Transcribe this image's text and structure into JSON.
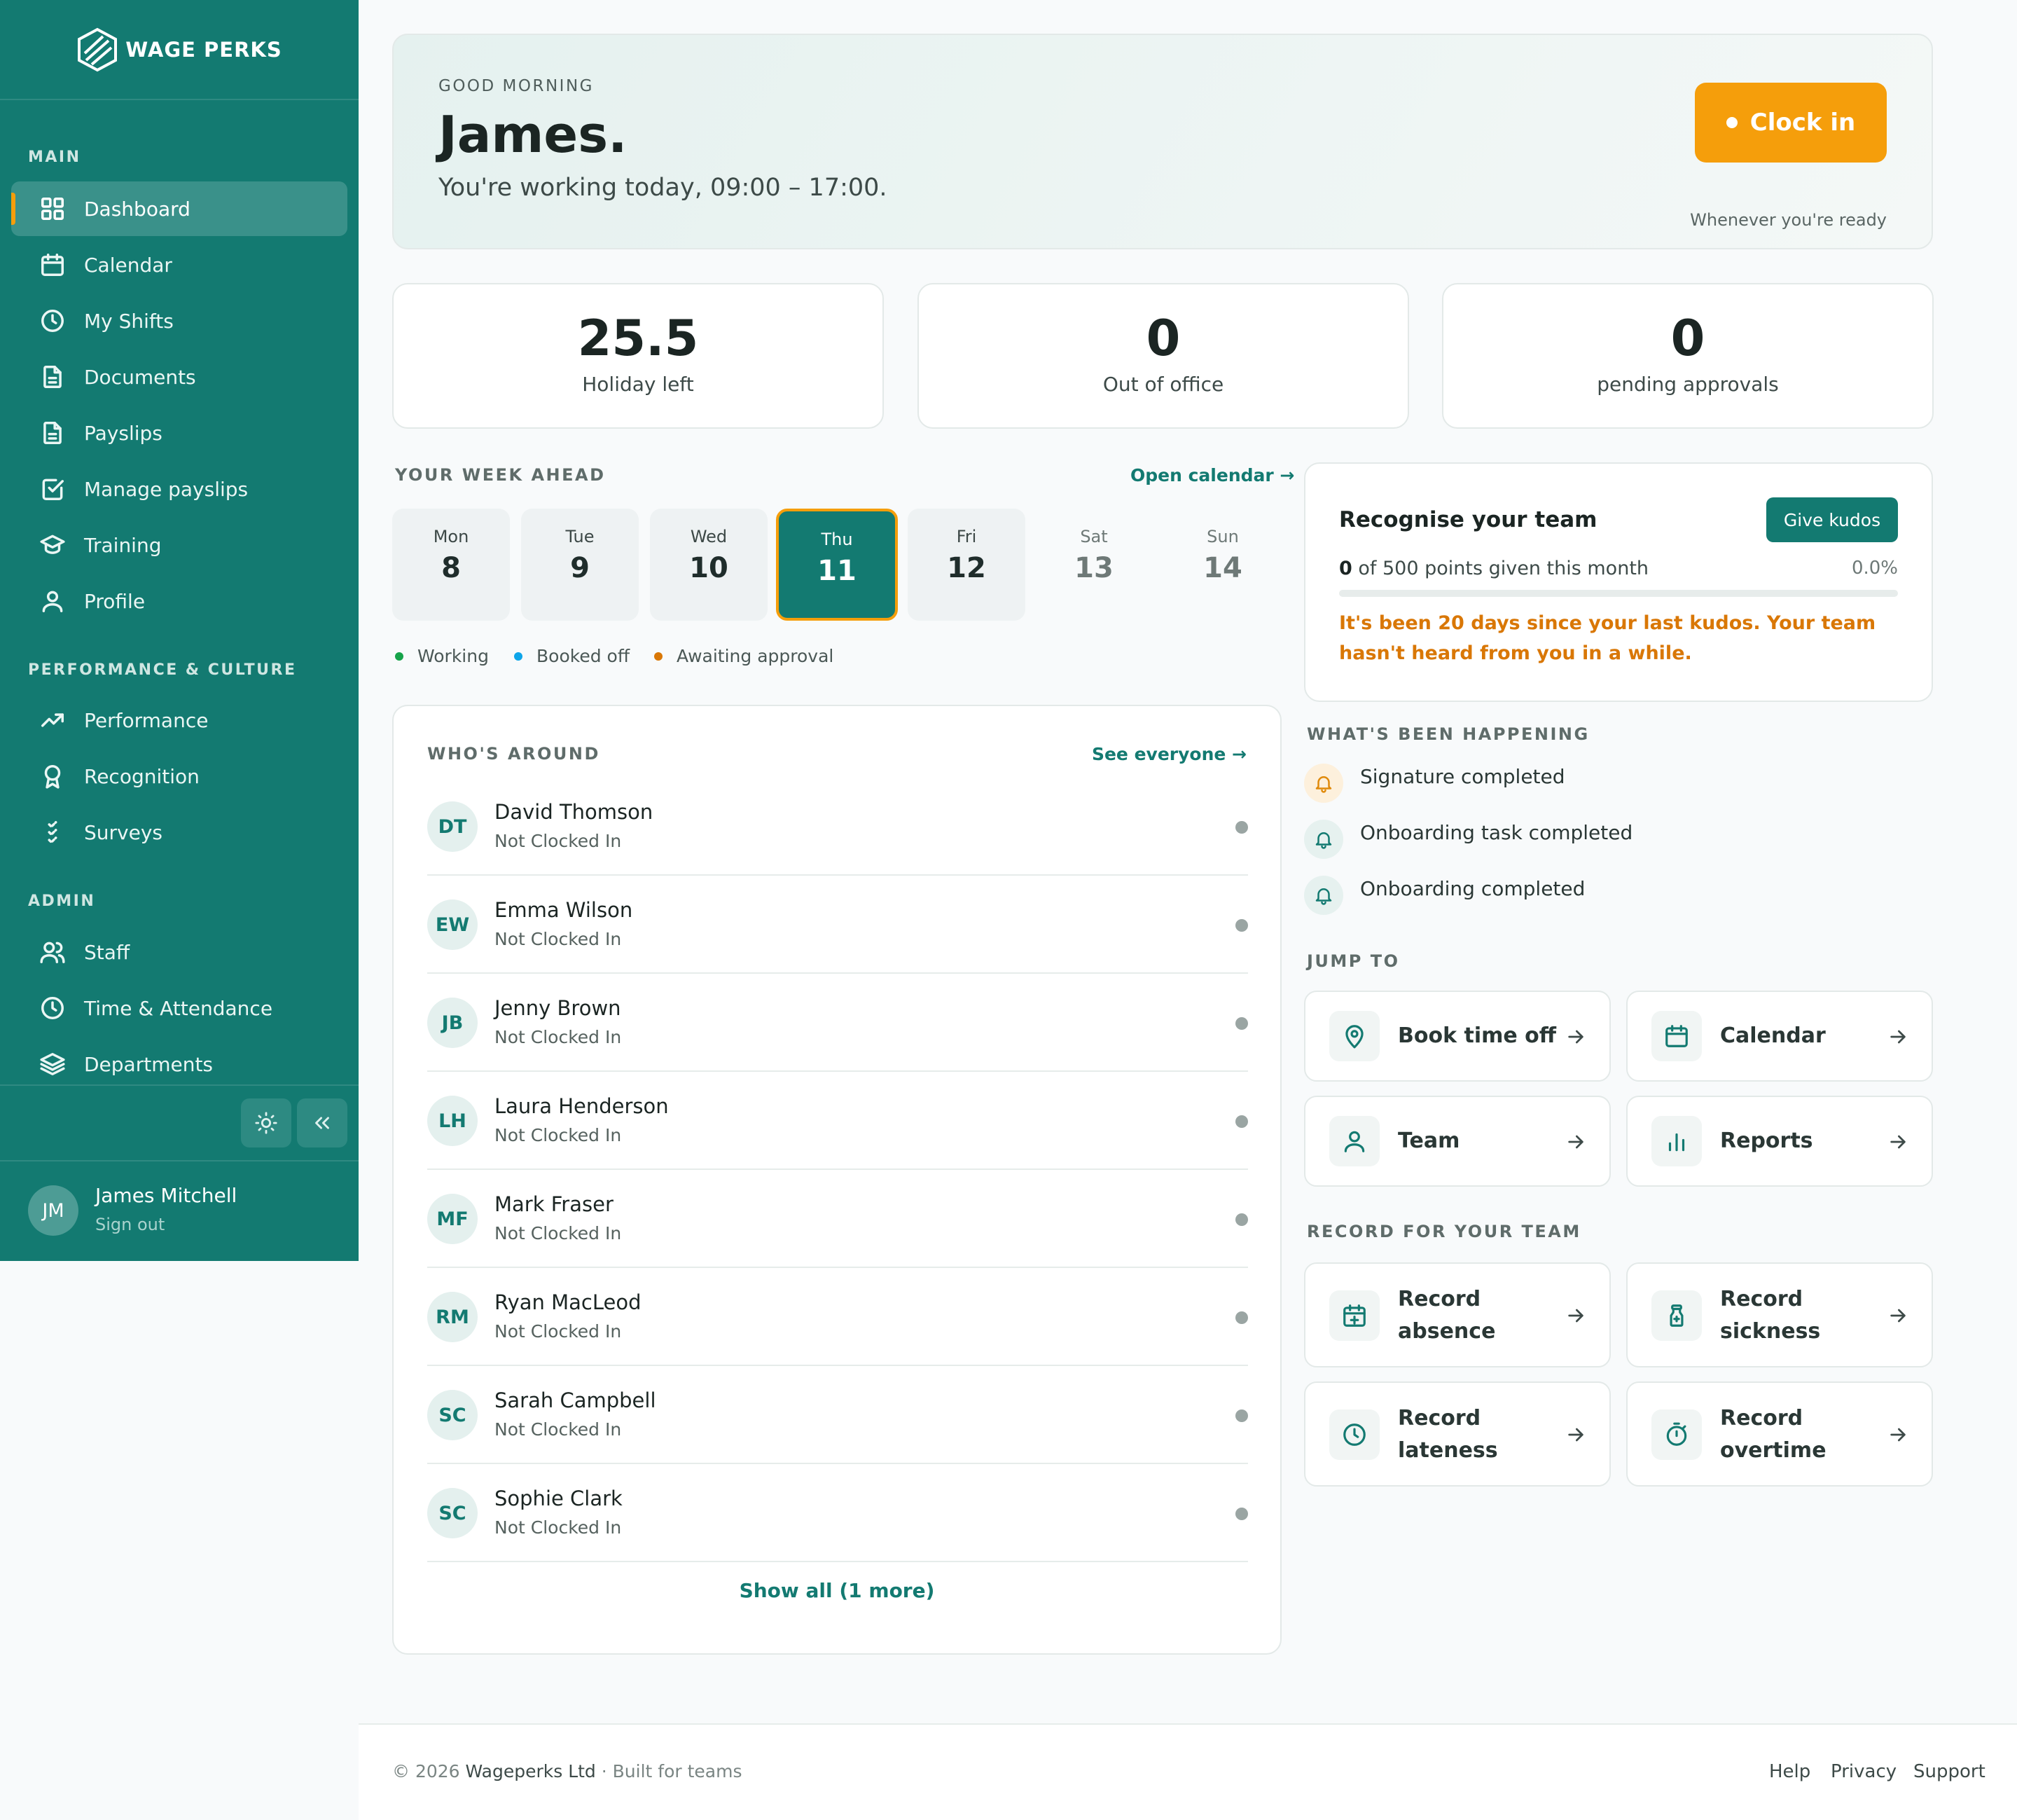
{
  "brand": {
    "name": "WAGE PERKS"
  },
  "sidebar": {
    "sections": {
      "main": "MAIN",
      "performance": "PERFORMANCE & CULTURE",
      "admin": "ADMIN"
    },
    "items": [
      {
        "label": "Dashboard",
        "icon": "grid-icon"
      },
      {
        "label": "Calendar",
        "icon": "calendar-icon"
      },
      {
        "label": "My Shifts",
        "icon": "clock-icon"
      },
      {
        "label": "Documents",
        "icon": "document-icon"
      },
      {
        "label": "Payslips",
        "icon": "document-icon"
      },
      {
        "label": "Manage payslips",
        "icon": "checkbox-icon"
      },
      {
        "label": "Training",
        "icon": "graduation-cap-icon"
      },
      {
        "label": "Profile",
        "icon": "user-icon"
      },
      {
        "label": "Performance",
        "icon": "trend-up-icon"
      },
      {
        "label": "Recognition",
        "icon": "award-icon"
      },
      {
        "label": "Surveys",
        "icon": "checklist-icon"
      },
      {
        "label": "Staff",
        "icon": "users-icon"
      },
      {
        "label": "Time & Attendance",
        "icon": "clock-icon"
      },
      {
        "label": "Departments",
        "icon": "layers-icon"
      }
    ],
    "user": {
      "initials": "JM",
      "name": "James Mitchell",
      "signout": "Sign out"
    }
  },
  "hero": {
    "eyebrow": "GOOD MORNING",
    "name": "James.",
    "subtitle": "You're working today, 09:00 – 17:00.",
    "clock_in": "Clock in",
    "clock_in_sub": "Whenever you're ready"
  },
  "stats": [
    {
      "value": "25.5",
      "label": "Holiday left"
    },
    {
      "value": "0",
      "label": "Out of office"
    },
    {
      "value": "0",
      "label": "pending approvals"
    }
  ],
  "week": {
    "title": "YOUR WEEK AHEAD",
    "link": "Open calendar →",
    "days": [
      {
        "name": "Mon",
        "num": "8"
      },
      {
        "name": "Tue",
        "num": "9"
      },
      {
        "name": "Wed",
        "num": "10"
      },
      {
        "name": "Thu",
        "num": "11"
      },
      {
        "name": "Fri",
        "num": "12"
      },
      {
        "name": "Sat",
        "num": "13"
      },
      {
        "name": "Sun",
        "num": "14"
      }
    ],
    "legend": [
      {
        "label": "Working",
        "color": "#16a34a"
      },
      {
        "label": "Booked off",
        "color": "#0ea5e9"
      },
      {
        "label": "Awaiting approval",
        "color": "#d97706"
      }
    ]
  },
  "who": {
    "title": "WHO'S AROUND",
    "link": "See everyone →",
    "people": [
      {
        "initials": "DT",
        "name": "David Thomson",
        "status": "Not Clocked In"
      },
      {
        "initials": "EW",
        "name": "Emma Wilson",
        "status": "Not Clocked In"
      },
      {
        "initials": "JB",
        "name": "Jenny Brown",
        "status": "Not Clocked In"
      },
      {
        "initials": "LH",
        "name": "Laura Henderson",
        "status": "Not Clocked In"
      },
      {
        "initials": "MF",
        "name": "Mark Fraser",
        "status": "Not Clocked In"
      },
      {
        "initials": "RM",
        "name": "Ryan MacLeod",
        "status": "Not Clocked In"
      },
      {
        "initials": "SC",
        "name": "Sarah Campbell",
        "status": "Not Clocked In"
      },
      {
        "initials": "SC",
        "name": "Sophie Clark",
        "status": "Not Clocked In"
      }
    ],
    "show_all": "Show all (1 more)"
  },
  "kudos": {
    "title": "Recognise your team",
    "button": "Give kudos",
    "points_value": "0",
    "points_text": " of 500 points given this month",
    "percent": "0.0%",
    "progress_fraction": 0,
    "warning": "It's been 20 days since your last kudos. Your team hasn't heard from you in a while."
  },
  "activity": {
    "title": "WHAT'S BEEN HAPPENING",
    "items": [
      {
        "text": "Signature completed",
        "icon": "bell-icon"
      },
      {
        "text": "Onboarding task completed",
        "icon": "bell-icon"
      },
      {
        "text": "Onboarding completed",
        "icon": "bell-icon"
      }
    ]
  },
  "jump": {
    "title": "JUMP TO",
    "tiles": [
      {
        "label": "Book time off",
        "icon": "map-pin-icon"
      },
      {
        "label": "Calendar",
        "icon": "calendar-icon"
      },
      {
        "label": "Team",
        "icon": "user-icon"
      },
      {
        "label": "Reports",
        "icon": "bar-chart-icon"
      }
    ]
  },
  "record": {
    "title": "RECORD FOR YOUR TEAM",
    "tiles": [
      {
        "line1": "Record",
        "line2": "absence",
        "icon": "calendar-plus-icon"
      },
      {
        "line1": "Record",
        "line2": "sickness",
        "icon": "medicine-bottle-icon"
      },
      {
        "line1": "Record",
        "line2": "lateness",
        "icon": "clock-icon"
      },
      {
        "line1": "Record",
        "line2": "overtime",
        "icon": "stopwatch-icon"
      }
    ]
  },
  "footer": {
    "copyright": "© 2026",
    "company": "Wageperks Ltd",
    "tagline": "· Built for teams",
    "links": [
      "Help",
      "Privacy",
      "Support"
    ]
  },
  "colors": {
    "brand": "#137a71",
    "accent": "#f59e0b",
    "warning": "#d97706"
  }
}
